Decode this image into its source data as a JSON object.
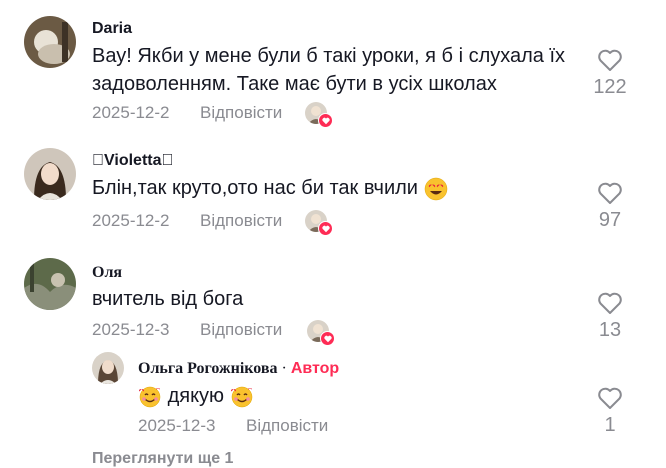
{
  "comments": [
    {
      "author": "Daria",
      "text": "Вау! Якби у мене були б такі уроки, я б і слухала їх задоволенням. Таке має бути в усіх школах",
      "date": "2025-12-2",
      "reply_label": "Відповісти",
      "likes": "122"
    },
    {
      "author": "\u0000Violetta\u0000",
      "text": "Блін,так круто,ото нас би так вчили",
      "date": "2025-12-2",
      "reply_label": "Відповісти",
      "likes": "97"
    },
    {
      "author": "Оля",
      "text": "вчитель від бога",
      "date": "2025-12-3",
      "reply_label": "Відповісти",
      "likes": "13"
    }
  ],
  "reply": {
    "author": "Ольга Рогожнікова",
    "separator": "·",
    "author_tag": "Автор",
    "text": "дякую",
    "date": "2025-12-3",
    "reply_label": "Відповісти",
    "likes": "1"
  },
  "more_replies_label": "Переглянути ще 1",
  "icons": {
    "like": "heart-outline-icon",
    "creator_liked": "heart-badge-icon",
    "emoji_smiling_hearts": "smiling-face-with-hearts-icon",
    "emoji_heart_eyes": "heart-eyes-icon"
  },
  "colors": {
    "accent": "#fe2c55",
    "text": "#161823",
    "muted": "#8a8b91"
  }
}
